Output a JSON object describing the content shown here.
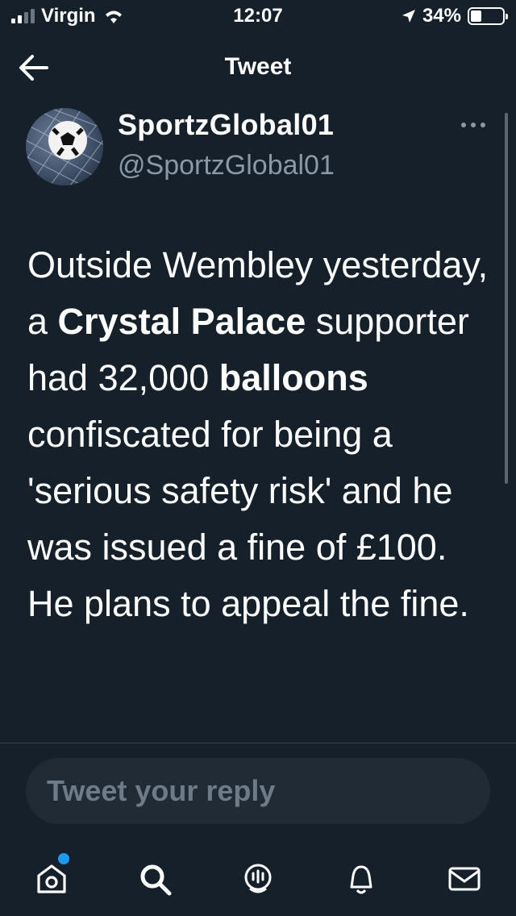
{
  "status_bar": {
    "carrier": "Virgin",
    "time": "12:07",
    "battery_percent": "34%",
    "battery_level": 0.34
  },
  "header": {
    "title": "Tweet"
  },
  "tweet": {
    "author_name": "SportzGlobal01",
    "author_handle": "@SportzGlobal01",
    "text_segments": [
      {
        "text": "Outside Wembley yesterday, a ",
        "bold": false
      },
      {
        "text": "Crystal Palace",
        "bold": true
      },
      {
        "text": " supporter had 32,000 ",
        "bold": false
      },
      {
        "text": "balloons",
        "bold": true
      },
      {
        "text": " confiscated for being a 'serious safety risk' and he was issued a fine of £100. He plans to appeal the fine.",
        "bold": false
      }
    ]
  },
  "reply": {
    "placeholder": "Tweet your reply"
  },
  "nav": {
    "items": [
      "home-icon",
      "search-icon",
      "spaces-icon",
      "notifications-icon",
      "messages-icon"
    ]
  },
  "colors": {
    "background": "#15202b",
    "accent": "#1d9bf0",
    "muted": "#8b98a5"
  }
}
